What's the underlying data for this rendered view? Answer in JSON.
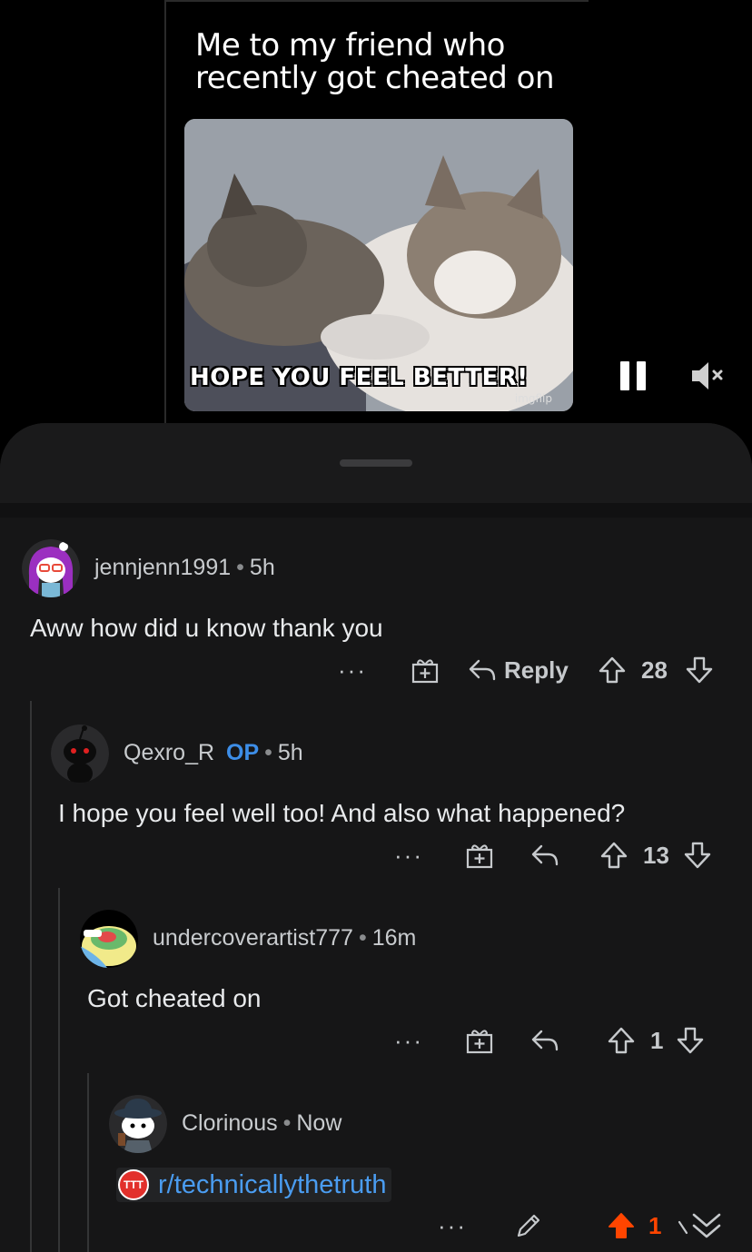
{
  "post": {
    "meme_caption": "Me to my friend who recently got cheated on",
    "gif_caption": "HOPE YOU FEEL BETTER!",
    "gif_watermark": "imgflip"
  },
  "comments": [
    {
      "username": "jennjenn1991",
      "time": "5h",
      "body": "Aww how did u know thank you",
      "reply_label": "Reply",
      "score": "28",
      "more": "···"
    },
    {
      "username": "Qexro_R",
      "op_badge": "OP",
      "time": "5h",
      "body": "I hope you feel well too! And also what happened?",
      "score": "13",
      "more": "···"
    },
    {
      "username": "undercoverartist777",
      "time": "16m",
      "body": "Got cheated on",
      "score": "1",
      "more": "···"
    },
    {
      "username": "Clorinous",
      "time": "Now",
      "link": "r/technicallythetruth",
      "link_badge": "TTT",
      "score": "1",
      "more": "···"
    }
  ],
  "colors": {
    "upvote_active": "#ff4500",
    "op_blue": "#3d8ee8",
    "link_blue": "#4a9cf0"
  }
}
